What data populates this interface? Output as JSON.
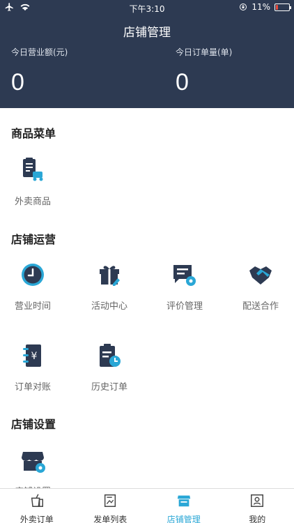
{
  "status_bar": {
    "time": "下午3:10",
    "battery": "11%"
  },
  "header": {
    "title": "店铺管理",
    "sales_label": "今日营业额(元)",
    "sales_value": "0",
    "orders_label": "今日订单量(单)",
    "orders_value": "0"
  },
  "sections": {
    "goods": {
      "title": "商品菜单",
      "items": [
        "外卖商品"
      ]
    },
    "operations": {
      "title": "店铺运营",
      "items": [
        "营业时间",
        "活动中心",
        "评价管理",
        "配送合作",
        "订单对账",
        "历史订单"
      ]
    },
    "settings": {
      "title": "店铺设置",
      "items": [
        "店铺设置"
      ]
    }
  },
  "tabs": [
    {
      "label": "外卖订单",
      "icon": "takeout-cup-icon"
    },
    {
      "label": "发单列表",
      "icon": "dispatch-list-icon"
    },
    {
      "label": "店铺管理",
      "icon": "store-icon"
    },
    {
      "label": "我的",
      "icon": "profile-card-icon"
    }
  ],
  "colors": {
    "header_bg": "#2d3a52",
    "icon_dark": "#2d3a52",
    "accent": "#2aa7d6",
    "battery_low": "#e94b3c"
  }
}
